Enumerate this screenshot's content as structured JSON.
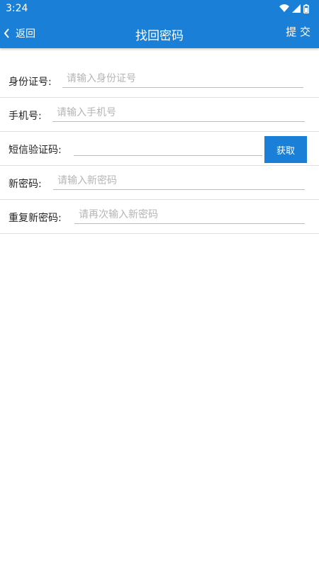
{
  "status_bar": {
    "time": "3:24",
    "icons": [
      "wifi-icon",
      "signal-icon",
      "battery-icon"
    ]
  },
  "header": {
    "back_label": "返回",
    "title": "找回密码",
    "submit_label": "提 交",
    "background_color": "#1a7fd6"
  },
  "form": {
    "id_number": {
      "label": "身份证号:",
      "placeholder": "请输入身份证号",
      "value": ""
    },
    "phone": {
      "label": "手机号:",
      "placeholder": "请输入手机号",
      "value": ""
    },
    "sms_code": {
      "label": "短信验证码:",
      "placeholder": "",
      "value": "",
      "button_label": "获取"
    },
    "new_password": {
      "label": "新密码:",
      "placeholder": "请输入新密码",
      "value": ""
    },
    "confirm_password": {
      "label": "重复新密码:",
      "placeholder": "请再次输入新密码",
      "value": ""
    }
  }
}
